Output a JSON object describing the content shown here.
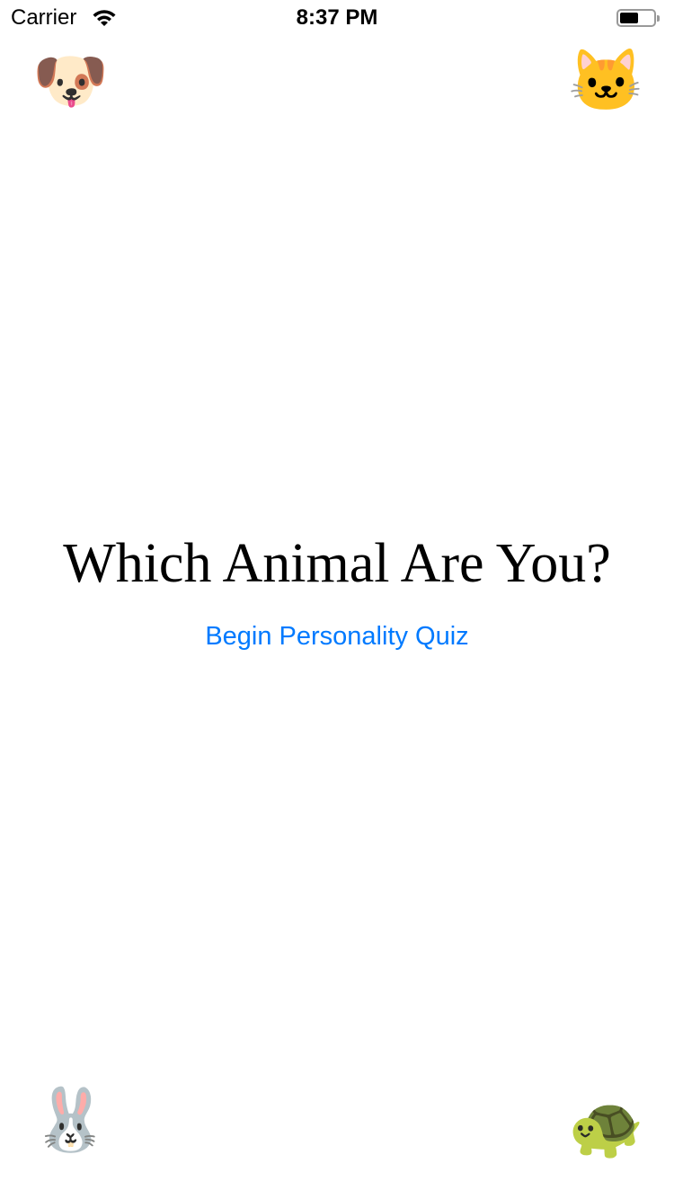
{
  "status_bar": {
    "carrier": "Carrier",
    "time": "8:37 PM",
    "battery_level": 0.55,
    "wifi_icon": "wifi-icon"
  },
  "emojis": {
    "top_left": "🐶",
    "top_right": "🐱",
    "bottom_left": "🐰",
    "bottom_right": "🐢"
  },
  "main": {
    "title": "Which Animal Are You?",
    "begin_button": "Begin Personality Quiz"
  },
  "colors": {
    "accent": "#007aff"
  }
}
